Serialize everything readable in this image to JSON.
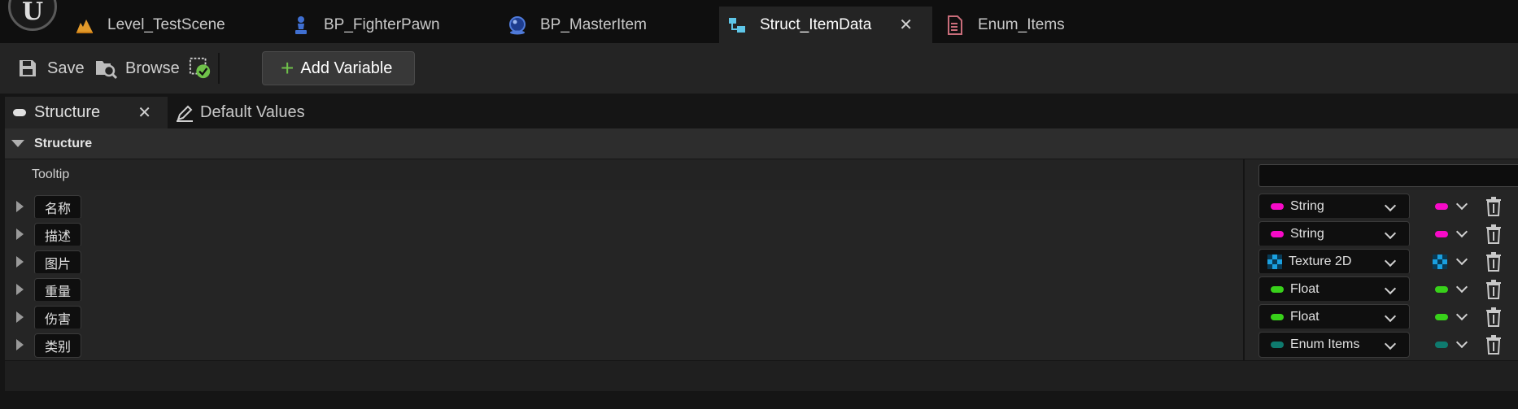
{
  "tabs": [
    {
      "label": "Level_TestScene",
      "icon": "level-icon",
      "active": false
    },
    {
      "label": "BP_FighterPawn",
      "icon": "pawn-icon",
      "active": false
    },
    {
      "label": "BP_MasterItem",
      "icon": "blueprint-actor-icon",
      "active": false
    },
    {
      "label": "Struct_ItemData",
      "icon": "struct-icon",
      "active": true,
      "close": "✕"
    },
    {
      "label": "Enum_Items",
      "icon": "enum-icon",
      "active": false
    }
  ],
  "toolbar": {
    "save_label": "Save",
    "browse_label": "Browse",
    "add_variable_label": "Add Variable"
  },
  "panel_tabs": [
    {
      "label": "Structure",
      "active": true,
      "close": "✕"
    },
    {
      "label": "Default Values",
      "active": false
    }
  ],
  "structure": {
    "category": "Structure",
    "tooltip_label": "Tooltip",
    "tooltip_value": "",
    "members": [
      {
        "name": "名称",
        "type": "String",
        "color": "#f70ac8"
      },
      {
        "name": "描述",
        "type": "String",
        "color": "#f70ac8"
      },
      {
        "name": "图片",
        "type": "Texture 2D",
        "color": "#1aa0e0"
      },
      {
        "name": "重量",
        "type": "Float",
        "color": "#38d11a"
      },
      {
        "name": "伤害",
        "type": "Float",
        "color": "#38d11a"
      },
      {
        "name": "类别",
        "type": "Enum Items",
        "color": "#0e7a6e"
      }
    ]
  },
  "colors": {
    "accent_green": "#6fc14a",
    "string": "#f70ac8",
    "float": "#38d11a",
    "enum": "#0e7a6e",
    "object": "#1aa0e0"
  }
}
